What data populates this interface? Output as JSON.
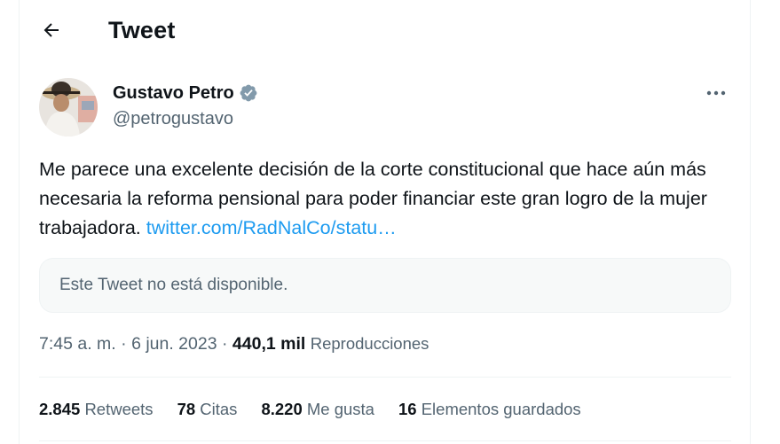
{
  "header": {
    "back_icon": "arrow-left-icon",
    "title": "Tweet"
  },
  "author": {
    "name": "Gustavo Petro",
    "handle": "@petrogustavo",
    "verified_icon": "verified-badge-icon",
    "verified_color": "#829aab",
    "more_icon": "more-horizontal-icon"
  },
  "tweet": {
    "text": "Me parece una excelente decisión de la corte constitucional que hace aún más necesaria la reforma pensional para poder financiar este gran logro de la mujer trabajadora.",
    "link": "twitter.com/RadNalCo/statu…",
    "link_color": "#1d9bf0"
  },
  "quote": {
    "unavailable_text": "Este Tweet no está disponible."
  },
  "meta": {
    "time": "7:45 a. m.",
    "separator1": "·",
    "date": "6 jun. 2023",
    "separator2": "·",
    "views_count": "440,1 mil",
    "views_label": "Reproducciones"
  },
  "stats": [
    {
      "count": "2.845",
      "label": "Retweets"
    },
    {
      "count": "78",
      "label": "Citas"
    },
    {
      "count": "8.220",
      "label": "Me gusta"
    },
    {
      "count": "16",
      "label": "Elementos guardados"
    }
  ]
}
